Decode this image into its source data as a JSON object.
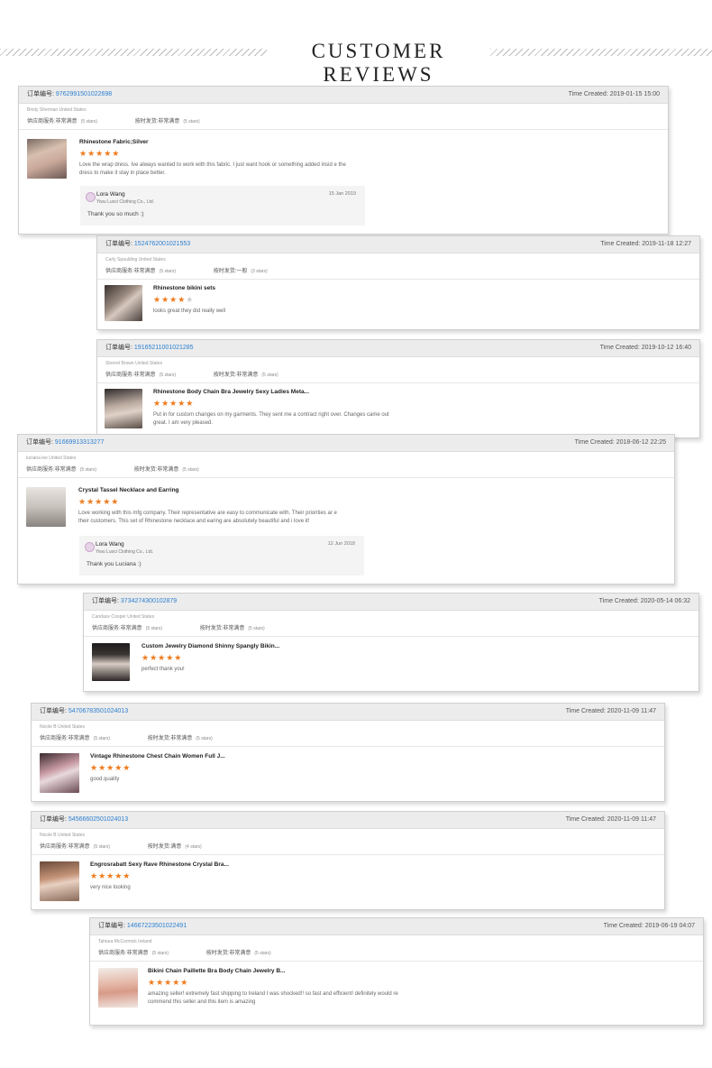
{
  "header": {
    "title": "CUSTOMER REVIEWS"
  },
  "labels": {
    "order_no": "订单编号:",
    "time_created": "Time Created:",
    "supplier_service": "供应商服务:",
    "on_time_shipping": "按时发货:"
  },
  "colors": {
    "accent_link": "#2a7fd0",
    "star": "#f07a1b",
    "card_header": "#ececec"
  },
  "reviews": [
    {
      "order": "97629915010226​98",
      "time": "2019-01-15 15:00",
      "buyer": "Bristy Sherman United States",
      "service": "非常满意",
      "service_stars": "(5 stars)",
      "shipping": "非常满意",
      "shipping_stars": "(5 stars)",
      "product": "Rhinestone Fabric;Silver",
      "rating": 5,
      "text": "Love the wrap dress. Ive always wanted to work with this fabric. I just want hook or something added insid e the dress to make it stay in place better.",
      "reply": {
        "name": "Lora Wang",
        "company": "Yiwu Luoci Clothing Co., Ltd.",
        "date": "15 Jan 2019",
        "message": "Thank you so much :)"
      }
    },
    {
      "order": "15247620010215​53",
      "time": "2019-11-18 12:27",
      "buyer": "Carly Spaulding United States",
      "service": "非常满意",
      "service_stars": "(5 stars)",
      "shipping": "一般",
      "shipping_stars": "(3 stars)",
      "product": "Rhinestone bikini sets",
      "rating": 4,
      "text": "looks great they did really well"
    },
    {
      "order": "19165211001021285",
      "time": "2019-10-12 16:40",
      "buyer": "Sherrel Brown United States",
      "service": "非常满意",
      "service_stars": "(5 stars)",
      "shipping": "非常满意",
      "shipping_stars": "(5 stars)",
      "product": "Rhinestone Body Chain Bra Jewelry Sexy Ladies Meta...",
      "rating": 5,
      "text": "Put in for custom changes on my garments. They sent me a contract right over. Changes came out great. I am very pleased."
    },
    {
      "order": "91669913313277",
      "time": "2018-06-12 22:25",
      "buyer": "luciana lee United States",
      "service": "非常满意",
      "service_stars": "(5 stars)",
      "shipping": "非常满意",
      "shipping_stars": "(5 stars)",
      "product": "Crystal Tassel Necklace and Earring",
      "rating": 5,
      "text": "Love working with this mfg company. Their representative are easy to communicate with. Their priorities ar e their customers. This set of Rhinestone necklace and earing are absolutely beautiful and i love it!",
      "reply": {
        "name": "Lora Wang",
        "company": "Yiwu Luoci Clothing Co., Ltd.",
        "date": "12 Jun 2018",
        "message": "Thank you Luciana :)"
      }
    },
    {
      "order": "37342743001028​79",
      "time": "2020-05-14 06:32",
      "buyer": "Candace Cooper United States",
      "service": "非常满意",
      "service_stars": "(5 stars)",
      "shipping": "非常满意",
      "shipping_stars": "(5 stars)",
      "product": "Custom Jewelry Diamond Shinny Spangly Bikin...",
      "rating": 5,
      "text": "perfect thank you!"
    },
    {
      "order": "54706783501024013",
      "time": "2020-11-09 11:47",
      "buyer": "Nicole B United States",
      "service": "非常满意",
      "service_stars": "(5 stars)",
      "shipping": "非常满意",
      "shipping_stars": "(5 stars)",
      "product": "Vintage Rhinestone Chest Chain Women Full J...",
      "rating": 5,
      "text": "good quality"
    },
    {
      "order": "54566602501024013",
      "time": "2020-11-09 11:47",
      "buyer": "Nicole B United States",
      "service": "非常满意",
      "service_stars": "(5 stars)",
      "shipping": "满意",
      "shipping_stars": "(4 stars)",
      "product": "Engrosrabatt Sexy Rave Rhinestone Crystal Bra...",
      "rating": 5,
      "text": "very nice looking"
    },
    {
      "order": "14667223501022491",
      "time": "2019-06-19 04:07",
      "buyer": "Tahiara McCormick Ireland",
      "service": "非常满意",
      "service_stars": "(5 stars)",
      "shipping": "非常满意",
      "shipping_stars": "(5 stars)",
      "product": "Bikini Chain Paillette Bra Body Chain Jewelry B...",
      "rating": 5,
      "text": "amazing seller! extremely fast shipping to Ireland I was shocked!! so fast and efficient! definitely would re commend this seller and this item is amazing"
    }
  ]
}
